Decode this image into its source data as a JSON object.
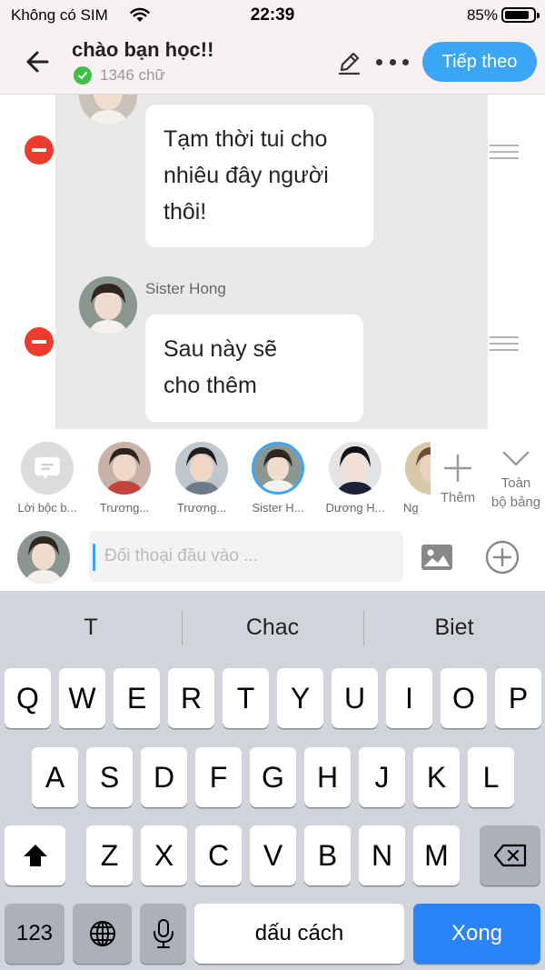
{
  "status_bar": {
    "carrier": "Không có SIM",
    "time": "22:39",
    "battery": "85%",
    "battery_level": 0.85
  },
  "header": {
    "title": "chào bạn học!!",
    "word_count": "1346 chữ",
    "next_label": "Tiếp theo"
  },
  "messages": [
    {
      "sender": "",
      "text_lines": [
        "Tạm thời tui cho",
        "nhiêu đây người",
        "thôi!"
      ]
    },
    {
      "sender": "Sister Hong",
      "text_lines": [
        "Sau này sẽ",
        "cho thêm"
      ]
    }
  ],
  "characters": [
    {
      "label": "Lời bộc b...",
      "selected": false
    },
    {
      "label": "Trương...",
      "selected": false
    },
    {
      "label": "Trương...",
      "selected": false
    },
    {
      "label": "Sister H...",
      "selected": true
    },
    {
      "label": "Dương H...",
      "selected": false
    },
    {
      "label": "Ng",
      "selected": false
    }
  ],
  "strip_actions": {
    "add_label": "Thêm",
    "expand_label_1": "Toàn",
    "expand_label_2": "bộ bảng"
  },
  "input": {
    "placeholder": "Đối thoại đầu vào ..."
  },
  "keyboard": {
    "suggestions": [
      "T",
      "Chac",
      "Biet"
    ],
    "row1": [
      "Q",
      "W",
      "E",
      "R",
      "T",
      "Y",
      "U",
      "I",
      "O",
      "P"
    ],
    "row2": [
      "A",
      "S",
      "D",
      "F",
      "G",
      "H",
      "J",
      "K",
      "L"
    ],
    "row3": [
      "Z",
      "X",
      "C",
      "V",
      "B",
      "N",
      "M"
    ],
    "numbers_label": "123",
    "space_label": "dấu cách",
    "done_label": "Xong"
  },
  "colors": {
    "accent": "#3ba6f5",
    "remove": "#ef3b2e",
    "check": "#3fbf4a"
  },
  "icons": [
    "wifi-icon",
    "back-arrow-icon",
    "check-icon",
    "pencil-icon",
    "more-dots-icon",
    "remove-icon",
    "drag-handle-icon",
    "narrator-icon",
    "plus-icon",
    "chevron-down-icon",
    "image-icon",
    "plus-circle-icon",
    "shift-icon",
    "backspace-icon",
    "globe-icon",
    "microphone-icon"
  ]
}
